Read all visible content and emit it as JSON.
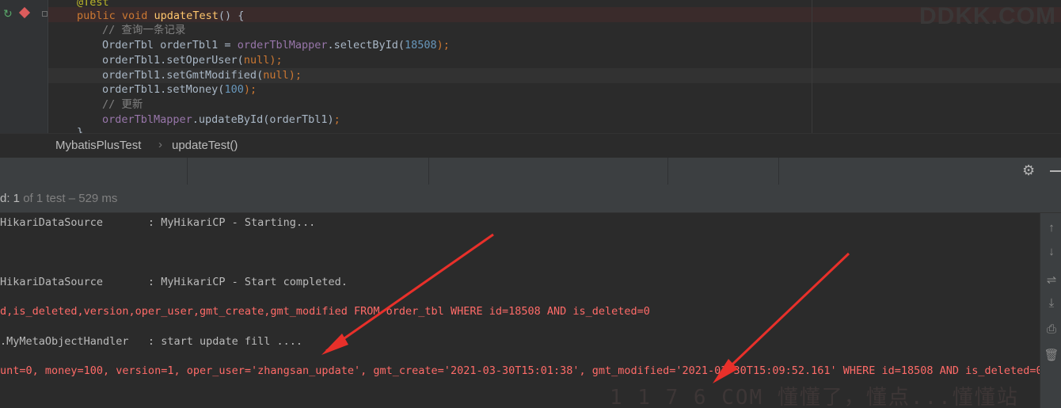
{
  "editor": {
    "lines": {
      "annotation": "@Test",
      "signature": {
        "mod": "public void ",
        "name": "updateTest",
        "rest": "() {"
      },
      "comment1": "// 查询一条记录",
      "select": {
        "type": "OrderTbl orderTbl1 = ",
        "mapper": "orderTblMapper",
        "call": ".selectById(",
        "arg": "18508",
        "end": ");"
      },
      "setOperUser": {
        "pre": "orderTbl1.setOperUser(",
        "arg": "null",
        "end": ");"
      },
      "setGmtModified": {
        "pre": "orderTbl1.setGmtModified(",
        "arg": "null",
        "end": ");"
      },
      "setMoney": {
        "pre": "orderTbl1.setMoney(",
        "arg": "100",
        "end": ");"
      },
      "comment2": "// 更新",
      "update": {
        "mapper": "orderTblMapper",
        "call": ".updateById(orderTbl1)",
        "end": ";"
      },
      "close": "}"
    },
    "watermark": "DDKK.COM",
    "colors": {
      "keyword": "#cc7832",
      "method": "#ffc66d",
      "comment": "#808080",
      "field": "#9876aa",
      "number": "#6897bb"
    }
  },
  "breadcrumb": {
    "class_name": "MybatisPlusTest",
    "separator": "›",
    "method_name": "updateTest()"
  },
  "status": {
    "passed_prefix": "d: 1",
    "passed_suffix": " of 1 test – 529 ms"
  },
  "console": {
    "lines": [
      {
        "text": "HikariDataSource       : MyHikariCP - Starting...",
        "style": "norm"
      },
      {
        "text": "HikariDataSource       : MyHikariCP - Start completed.",
        "style": "norm"
      },
      {
        "text": "d,is_deleted,version,oper_user,gmt_create,gmt_modified FROM order_tbl WHERE id=18508 AND is_deleted=0",
        "style": "red"
      },
      {
        "text": ".MyMetaObjectHandler   : start update fill ....",
        "style": "norm"
      },
      {
        "text": "unt=0, money=100, version=1, oper_user='zhangsan_update', gmt_create='2021-03-30T15:01:38', gmt_modified='2021-03-30T15:09:52.161' WHERE id=18508 AND is_deleted=0",
        "style": "red"
      }
    ],
    "watermark": "1 1 7 6 COM 懂懂了，懂点...懂懂站"
  },
  "icons": {
    "run": "run-test-icon",
    "breakpoint": "breakpoint-icon",
    "settings": "gear-icon",
    "minimize": "minimize-icon"
  },
  "arrow_color": "#e8302a"
}
